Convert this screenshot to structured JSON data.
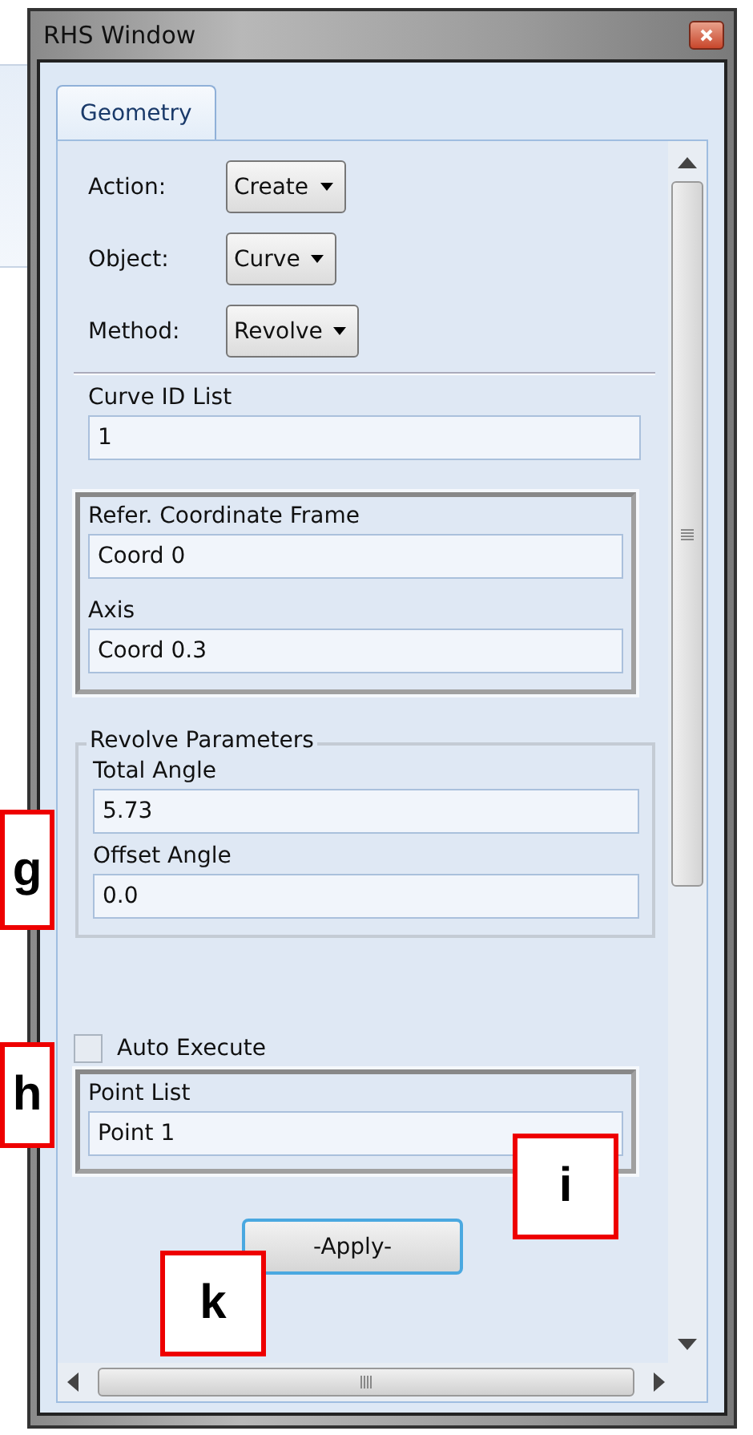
{
  "window": {
    "title": "RHS Window"
  },
  "tabs": [
    {
      "label": "Geometry",
      "selected": true
    }
  ],
  "selectors": [
    {
      "label": "Action:",
      "value": "Create"
    },
    {
      "label": "Object:",
      "value": "Curve"
    },
    {
      "label": "Method:",
      "value": "Revolve"
    }
  ],
  "curve_id_list": {
    "label": "Curve ID List",
    "value": "1"
  },
  "frame_group": {
    "fields": [
      {
        "label": "Refer. Coordinate Frame",
        "value": "Coord 0"
      },
      {
        "label": "Axis",
        "value": "Coord 0.3"
      }
    ]
  },
  "revolve_parameters": {
    "title": "Revolve Parameters",
    "fields": [
      {
        "label": "Total Angle",
        "value": "5.73"
      },
      {
        "label": "Offset Angle",
        "value": "0.0"
      }
    ]
  },
  "auto_execute": {
    "label": "Auto Execute",
    "checked": false
  },
  "point_list": {
    "label": "Point List",
    "value": "Point 1"
  },
  "apply_button": {
    "label": "-Apply-"
  },
  "callouts": [
    "g",
    "h",
    "i",
    "k"
  ]
}
